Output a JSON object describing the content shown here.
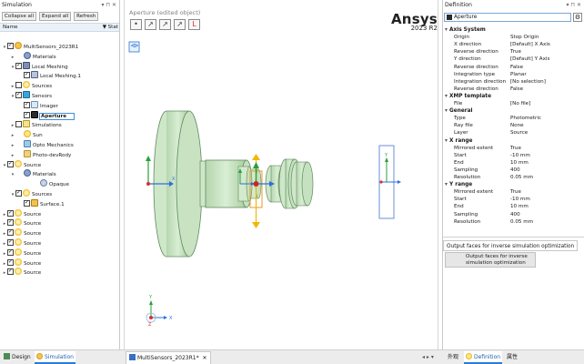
{
  "left_panel": {
    "title": "Simulation",
    "title_controls": "▾ ⊓ ✕",
    "buttons": {
      "collapse": "Collapse all",
      "expand": "Expand all",
      "refresh": "Refresh"
    },
    "columns": {
      "name": "Name",
      "filter": "▼",
      "status": "Stat"
    },
    "tree": [
      {
        "label": "MultiSensors_2023R1",
        "icon": "simulation-icon",
        "checked": true,
        "twisty": "▾",
        "indent": 0
      },
      {
        "label": "Materials",
        "icon": "materials-icon",
        "checked": null,
        "twisty": "▸",
        "indent": 1
      },
      {
        "label": "Local Meshing",
        "icon": "mesh-icon",
        "checked": true,
        "twisty": "▾",
        "indent": 1
      },
      {
        "label": "Local Meshing.1",
        "icon": "mesh-item-icon",
        "checked": true,
        "twisty": "",
        "indent": 2
      },
      {
        "label": "Sources",
        "icon": "source-icon",
        "checked": false,
        "twisty": "▸",
        "indent": 1
      },
      {
        "label": "Sensors",
        "icon": "sensor-icon",
        "checked": true,
        "twisty": "▾",
        "indent": 1
      },
      {
        "label": "Imager",
        "icon": "imager-icon",
        "checked": true,
        "twisty": "",
        "indent": 2
      },
      {
        "label": "Aperture",
        "icon": "aperture-icon",
        "checked": true,
        "twisty": "",
        "indent": 2,
        "selected": true
      },
      {
        "label": "Simulations",
        "icon": "simulations-icon",
        "checked": false,
        "twisty": "▸",
        "indent": 1
      },
      {
        "label": "Sun",
        "icon": "sun-icon",
        "checked": null,
        "twisty": "▸",
        "indent": 1
      },
      {
        "label": "Opto Mechanics",
        "icon": "opto-icon",
        "checked": null,
        "twisty": "▸",
        "indent": 1
      },
      {
        "label": "Photo-devRody",
        "icon": "photo-icon",
        "checked": null,
        "twisty": "▸",
        "indent": 1
      },
      {
        "label": "Source",
        "icon": "source-icon",
        "checked": true,
        "twisty": "▾",
        "indent": 0
      },
      {
        "label": "Materials",
        "icon": "materials-icon",
        "checked": null,
        "twisty": "▾",
        "indent": 1
      },
      {
        "label": "Opaque",
        "icon": "opaque-icon",
        "checked": null,
        "twisty": "",
        "indent": 3
      },
      {
        "label": "Sources",
        "icon": "source-icon",
        "checked": true,
        "twisty": "▾",
        "indent": 1
      },
      {
        "label": "Surface.1",
        "icon": "surface-icon",
        "checked": true,
        "twisty": "",
        "indent": 2
      },
      {
        "label": "Source",
        "icon": "source-icon",
        "checked": true,
        "twisty": "▸",
        "indent": 0
      },
      {
        "label": "Source",
        "icon": "source-icon",
        "checked": true,
        "twisty": "▸",
        "indent": 0
      },
      {
        "label": "Source",
        "icon": "source-icon",
        "checked": true,
        "twisty": "▸",
        "indent": 0
      },
      {
        "label": "Source",
        "icon": "source-icon",
        "checked": true,
        "twisty": "▸",
        "indent": 0
      },
      {
        "label": "Source",
        "icon": "source-icon",
        "checked": true,
        "twisty": "▸",
        "indent": 0
      },
      {
        "label": "Source",
        "icon": "source-icon",
        "checked": true,
        "twisty": "▸",
        "indent": 0
      },
      {
        "label": "Source",
        "icon": "source-icon",
        "checked": true,
        "twisty": "▸",
        "indent": 0
      }
    ]
  },
  "viewport": {
    "title": "Aperture (edited object)",
    "toolbar_icons": [
      "dot-select-icon",
      "move-icon",
      "rotate-icon",
      "scale-icon",
      "axis-icon"
    ],
    "toolbar_glyphs": [
      "•",
      "↗",
      "↗",
      "↗",
      "L"
    ],
    "brand_name": "Ansys",
    "brand_version": "2023 R2",
    "axis_labels": {
      "x": "X",
      "y": "Y",
      "z": "Z"
    }
  },
  "definition": {
    "title": "Definition",
    "title_controls": "▾ ⊓ ✕",
    "name_value": "Aperture",
    "sections": [
      {
        "title": "Axis System",
        "props": [
          {
            "k": "Origin",
            "v": "Stop Origin"
          },
          {
            "k": "X direction",
            "v": "[Default] X Axis"
          },
          {
            "k": "Reverse direction",
            "v": "True"
          },
          {
            "k": "Y direction",
            "v": "[Default] Y Axis"
          },
          {
            "k": "Reverse direction",
            "v": "False"
          },
          {
            "k": "Integration type",
            "v": "Planar"
          },
          {
            "k": "Integration direction",
            "v": "[No selection]"
          },
          {
            "k": "Reverse direction",
            "v": "False"
          }
        ]
      },
      {
        "title": "XMP template",
        "props": [
          {
            "k": "File",
            "v": "[No file]"
          }
        ]
      },
      {
        "title": "General",
        "props": [
          {
            "k": "Type",
            "v": "Photometric"
          },
          {
            "k": "Ray file",
            "v": "None"
          },
          {
            "k": "Layer",
            "v": "Source"
          }
        ]
      },
      {
        "title": "X range",
        "props": [
          {
            "k": "Mirrored extent",
            "v": "True"
          },
          {
            "k": "Start",
            "v": "-10 mm"
          },
          {
            "k": "End",
            "v": "10 mm"
          },
          {
            "k": "Sampling",
            "v": "400"
          },
          {
            "k": "Resolution",
            "v": "0.05 mm"
          }
        ]
      },
      {
        "title": "Y range",
        "props": [
          {
            "k": "Mirrored extent",
            "v": "True"
          },
          {
            "k": "Start",
            "v": "-10 mm"
          },
          {
            "k": "End",
            "v": "10 mm"
          },
          {
            "k": "Sampling",
            "v": "400"
          },
          {
            "k": "Resolution",
            "v": "0.05 mm"
          }
        ]
      }
    ],
    "lower_tab": "Output faces for inverse simulation optimization",
    "lower_button": "Output faces for inverse simulation optimization"
  },
  "bottom_tabs": {
    "design": "Design",
    "simulation": "Simulation",
    "document": "MultiSensors_2023R1*",
    "doc_close": "✕",
    "nav": "◂ ▸ ▾",
    "appearance": "外观",
    "definition": "Definition",
    "properties": "属性"
  },
  "colors": {
    "accent": "#2c7ad6",
    "model_green": "#c9e5c3",
    "model_edge": "#5f8a5f",
    "axis_x": "#2d6fd8",
    "axis_y": "#28a03a",
    "axis_z": "#d93030",
    "gizmo_orange": "#f2b705"
  }
}
